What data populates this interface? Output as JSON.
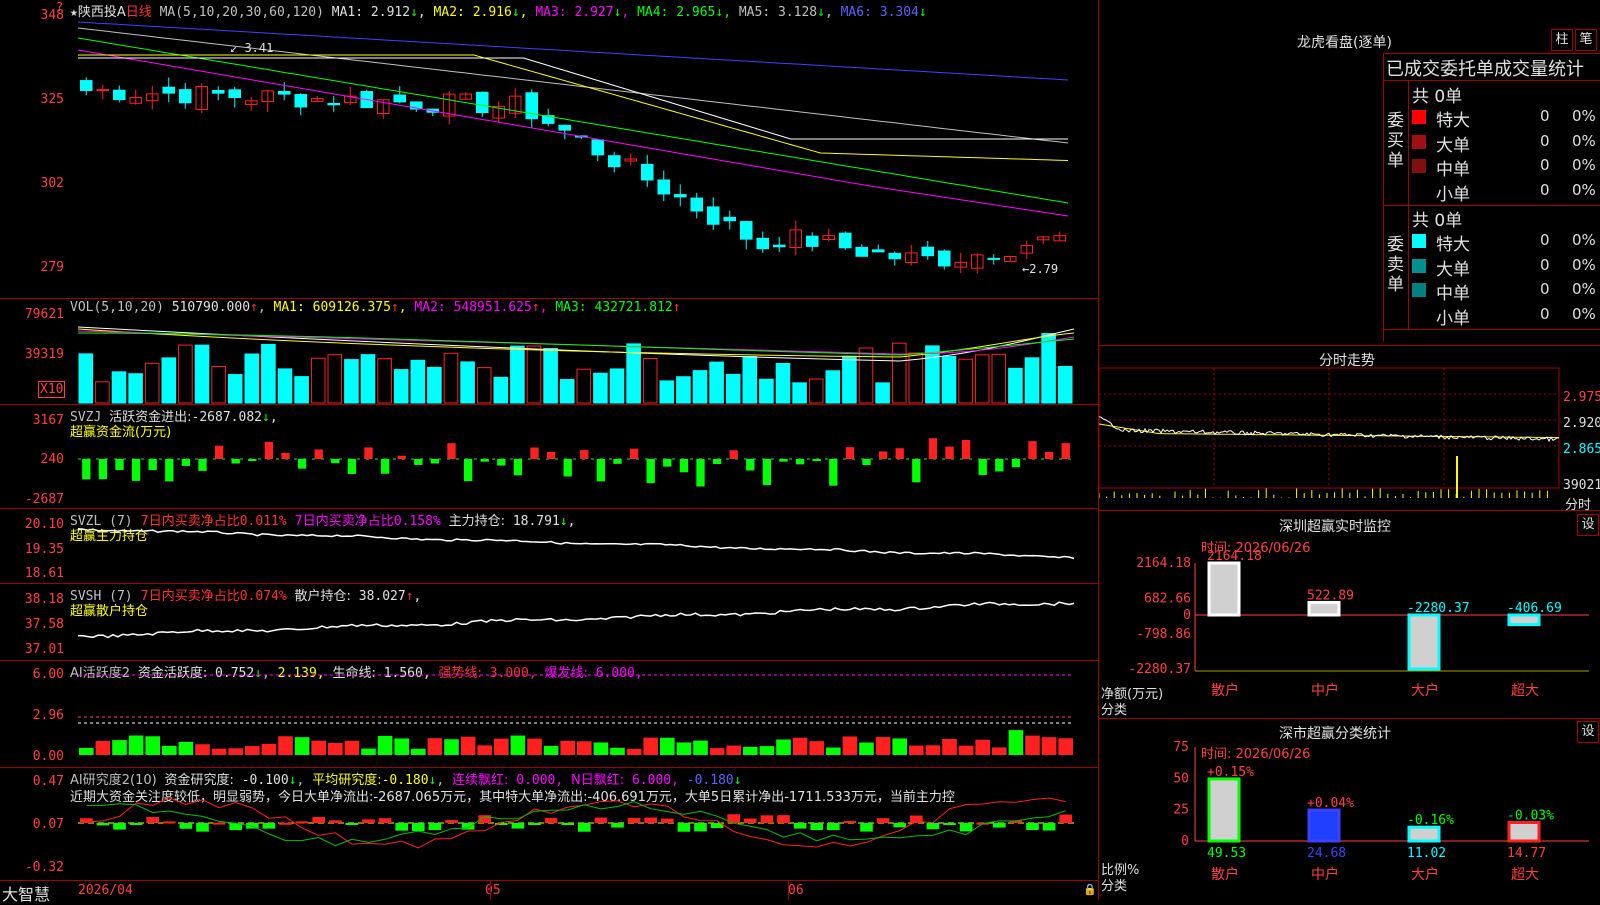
{
  "app_name": "大智慧",
  "stock": {
    "name": "陕西投A",
    "period": "日线"
  },
  "colors": {
    "up": "#ff2020",
    "down": "#00ffff",
    "ma1": "#ffffff",
    "ma2": "#ffff00",
    "ma3": "#ff00ff",
    "ma4": "#00ff00",
    "ma5": "#c0c0c0",
    "ma6": "#4040ff"
  },
  "price_panel": {
    "ma_params": "MA(5,10,20,30,60,120)",
    "ma_values": [
      {
        "label": "MA1:",
        "value": "2.912",
        "arrow": "↓"
      },
      {
        "label": "MA2:",
        "value": "2.916",
        "arrow": "↓"
      },
      {
        "label": "MA3:",
        "value": "2.927",
        "arrow": "↓"
      },
      {
        "label": "MA4:",
        "value": "2.965",
        "arrow": "↓"
      },
      {
        "label": "MA5:",
        "value": "3.128",
        "arrow": "↓"
      },
      {
        "label": "MA6:",
        "value": "3.304",
        "arrow": "↓"
      }
    ],
    "y_ticks": [
      "348",
      "325",
      "302",
      "279"
    ],
    "high_label": "3.41",
    "low_label": "←2.79"
  },
  "vol_panel": {
    "header": "VOL(5,10,20)",
    "value": "510790.000",
    "ma": [
      {
        "label": "MA1:",
        "value": "609126.375",
        "arrow": "↑"
      },
      {
        "label": "MA2:",
        "value": "548951.625",
        "arrow": "↑"
      },
      {
        "label": "MA3:",
        "value": "432721.812",
        "arrow": "↑"
      }
    ],
    "y_ticks": [
      "79621",
      "39319"
    ],
    "unit": "X10"
  },
  "svzj_panel": {
    "header": "SVZJ",
    "text": "活跃资金进出:",
    "value": "-2687.082",
    "arrow": "↓",
    "sub": "超赢资金流(万元)",
    "y_ticks": [
      "3167",
      "240",
      "-2687"
    ]
  },
  "svzl_panel": {
    "header": "SVZL (7)",
    "t1": "7日内买卖净占比",
    "v1": "0.011%",
    "t2": "7日内买卖净占比",
    "v2": "0.158%",
    "t3": "主力持仓:",
    "v3": "18.791",
    "arrow": "↓",
    "sub": "超赢主力持仓",
    "y_ticks": [
      "20.10",
      "19.35",
      "18.61"
    ]
  },
  "svsh_panel": {
    "header": "SVSH (7)",
    "t1": "7日内买卖净占比",
    "v1": "0.074%",
    "t2": "散户持仓:",
    "v2": "38.027",
    "arrow": "↑",
    "sub": "超赢散户持仓",
    "y_ticks": [
      "38.18",
      "37.58",
      "37.01"
    ]
  },
  "ai_active_panel": {
    "header": "AI活跃度2",
    "t1": "资金活跃度:",
    "v1": "0.752",
    "v2": "2.139,",
    "t3": "生命线:",
    "v3": "1.560,",
    "t4": "强势线:",
    "v4": "3.000,",
    "t5": "爆发线:",
    "v5": "6.000,",
    "y_ticks": [
      "6.00",
      "2.96",
      "0.00"
    ]
  },
  "ai_research_panel": {
    "header": "AI研究度2(10)",
    "t1": "资金研究度:",
    "v1": "-0.100",
    "t2": "平均研究度:",
    "v2": "-0.180",
    "t3": "连续飘红:",
    "v3": "0.000,",
    "t4": "N日飘红:",
    "v4": "6.000,",
    "v5": "-0.180",
    "comment": "近期大资金关注度较低，明显弱势，今日大单净流出:-2687.065万元，其中特大单净流出:-406.691万元，大单5日累计净出-1711.533万元，当前主力控",
    "y_ticks": [
      "0.47",
      "0.07",
      "-0.32"
    ]
  },
  "date_axis": [
    "2026/04",
    "05",
    "06"
  ],
  "dragon_tiger": {
    "title": "龙虎看盘(逐单)",
    "btn_bar": "柱",
    "btn_pen": "笔",
    "stat_title": "已成交委托单成交量统计",
    "buy": {
      "side": "委买单",
      "total": "共 0单",
      "rows": [
        {
          "name": "特大",
          "value": "0",
          "pct": "0%",
          "color": "#ff0000"
        },
        {
          "name": "大单",
          "value": "0",
          "pct": "0%",
          "color": "#a01010"
        },
        {
          "name": "中单",
          "value": "0",
          "pct": "0%",
          "color": "#801010"
        },
        {
          "name": "小单",
          "value": "0",
          "pct": "0%",
          "color": ""
        }
      ]
    },
    "sell": {
      "side": "委卖单",
      "total": "共 0单",
      "rows": [
        {
          "name": "特大",
          "value": "0",
          "pct": "0%",
          "color": "#00ffff"
        },
        {
          "name": "大单",
          "value": "0",
          "pct": "0%",
          "color": "#009090"
        },
        {
          "name": "中单",
          "value": "0",
          "pct": "0%",
          "color": "#008080"
        },
        {
          "name": "小单",
          "value": "0",
          "pct": "0%",
          "color": ""
        }
      ]
    }
  },
  "intraday": {
    "title": "分时走势",
    "y_ticks": [
      "2.975",
      "2.920",
      "2.865"
    ],
    "vol_label": "39021",
    "bottom_label": "分时"
  },
  "sz_monitor": {
    "title": "深圳超赢实时监控",
    "settings": "设",
    "date_label": "时间: 2026/06/26",
    "y_ticks": [
      "2164.18",
      "682.66",
      "0",
      "-798.86",
      "-2280.37"
    ],
    "y_label": "净额(万元)",
    "x_label": "分类",
    "bars": [
      {
        "cat": "散户",
        "value": 2164.18,
        "label": "2164.18"
      },
      {
        "cat": "中户",
        "value": 522.89,
        "label": "522.89"
      },
      {
        "cat": "大户",
        "value": -2280.37,
        "label": "-2280.37"
      },
      {
        "cat": "超大",
        "value": -406.69,
        "label": "-406.69"
      }
    ]
  },
  "sz_class": {
    "title": "深市超赢分类统计",
    "settings": "设",
    "date_label": "时间: 2026/06/26",
    "y_ticks": [
      "75",
      "50",
      "25",
      "0"
    ],
    "y_label": "比例%",
    "x_label": "分类",
    "bars": [
      {
        "cat": "散户",
        "pct": 49.53,
        "label": "49.53",
        "change": "+0.15%"
      },
      {
        "cat": "中户",
        "pct": 24.68,
        "label": "24.68",
        "change": "+0.04%"
      },
      {
        "cat": "大户",
        "pct": 11.02,
        "label": "11.02",
        "change": "-0.16%"
      },
      {
        "cat": "超大",
        "pct": 14.77,
        "label": "14.77",
        "change": "-0.03%"
      }
    ]
  }
}
